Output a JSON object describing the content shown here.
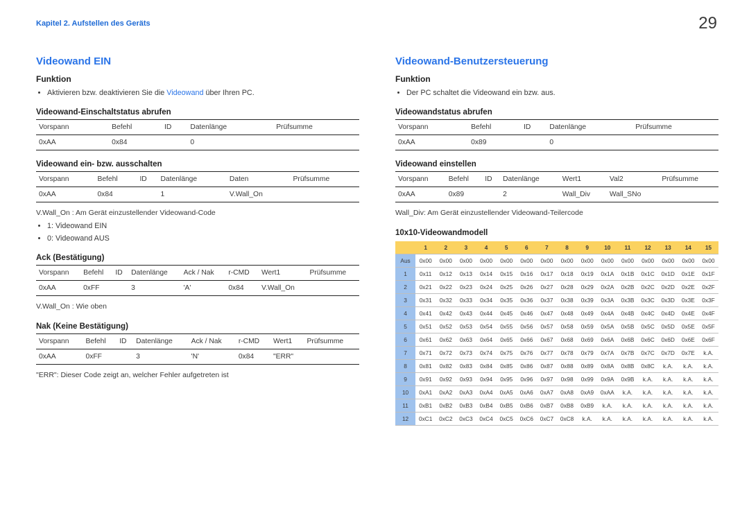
{
  "page": {
    "number": "29",
    "chapter": "Kapitel 2. Aufstellen des Geräts"
  },
  "left": {
    "title": "Videowand EIN",
    "func_h": "Funktion",
    "func_bullet_pre": "Aktivieren bzw. deaktivieren Sie die ",
    "func_bullet_accent": "Videowand",
    "func_bullet_post": " über Ihren PC.",
    "sec1_h": "Videowand-Einschaltstatus abrufen",
    "sec1_head": [
      "Vorspann",
      "Befehl",
      "ID",
      "Datenlänge",
      "Prüfsumme"
    ],
    "sec1_row": [
      "0xAA",
      "0x84",
      "",
      "0",
      ""
    ],
    "sec2_h": "Videowand ein- bzw. ausschalten",
    "sec2_head": [
      "Vorspann",
      "Befehl",
      "ID",
      "Datenlänge",
      "Daten",
      "Prüfsumme"
    ],
    "sec2_row": [
      "0xAA",
      "0x84",
      "",
      "1",
      "V.Wall_On",
      ""
    ],
    "vwall_note": "V.Wall_On : Am Gerät einzustellender Videowand-Code",
    "vwall_li1": "1: Videowand EIN",
    "vwall_li2": "0: Videowand AUS",
    "ack_h": "Ack (Bestätigung)",
    "ack_head": [
      "Vorspann",
      "Befehl",
      "ID",
      "Datenlänge",
      "Ack / Nak",
      "r-CMD",
      "Wert1",
      "Prüfsumme"
    ],
    "ack_row": [
      "0xAA",
      "0xFF",
      "",
      "3",
      "'A'",
      "0x84",
      "V.Wall_On",
      ""
    ],
    "ack_note": "V.Wall_On : Wie oben",
    "nak_h": "Nak (Keine Bestätigung)",
    "nak_head": [
      "Vorspann",
      "Befehl",
      "ID",
      "Datenlänge",
      "Ack / Nak",
      "r-CMD",
      "Wert1",
      "Prüfsumme"
    ],
    "nak_row": [
      "0xAA",
      "0xFF",
      "",
      "3",
      "'N'",
      "0x84",
      "\"ERR\"",
      ""
    ],
    "err_note": "\"ERR\": Dieser Code zeigt an, welcher Fehler aufgetreten ist"
  },
  "right": {
    "title": "Videowand-Benutzersteuerung",
    "func_h": "Funktion",
    "func_bullet": "Der PC schaltet die Videowand ein bzw. aus.",
    "sec1_h": "Videowandstatus abrufen",
    "sec1_head": [
      "Vorspann",
      "Befehl",
      "ID",
      "Datenlänge",
      "Prüfsumme"
    ],
    "sec1_row": [
      "0xAA",
      "0x89",
      "",
      "0",
      ""
    ],
    "sec2_h": "Videowand einstellen",
    "sec2_head": [
      "Vorspann",
      "Befehl",
      "ID",
      "Datenlänge",
      "Wert1",
      "Val2",
      "Prüfsumme"
    ],
    "sec2_row": [
      "0xAA",
      "0x89",
      "",
      "2",
      "Wall_Div",
      "Wall_SNo",
      ""
    ],
    "wall_div_note": "Wall_Div: Am Gerät einzustellender Videowand-Teilercode",
    "matrix_h": "10x10-Videowandmodell"
  },
  "matrix": {
    "col_head": [
      "",
      "1",
      "2",
      "3",
      "4",
      "5",
      "6",
      "7",
      "8",
      "9",
      "10",
      "11",
      "12",
      "13",
      "14",
      "15"
    ],
    "rows": [
      {
        "h": "Aus",
        "c": [
          "0x00",
          "0x00",
          "0x00",
          "0x00",
          "0x00",
          "0x00",
          "0x00",
          "0x00",
          "0x00",
          "0x00",
          "0x00",
          "0x00",
          "0x00",
          "0x00",
          "0x00"
        ]
      },
      {
        "h": "1",
        "c": [
          "0x11",
          "0x12",
          "0x13",
          "0x14",
          "0x15",
          "0x16",
          "0x17",
          "0x18",
          "0x19",
          "0x1A",
          "0x1B",
          "0x1C",
          "0x1D",
          "0x1E",
          "0x1F"
        ]
      },
      {
        "h": "2",
        "c": [
          "0x21",
          "0x22",
          "0x23",
          "0x24",
          "0x25",
          "0x26",
          "0x27",
          "0x28",
          "0x29",
          "0x2A",
          "0x2B",
          "0x2C",
          "0x2D",
          "0x2E",
          "0x2F"
        ]
      },
      {
        "h": "3",
        "c": [
          "0x31",
          "0x32",
          "0x33",
          "0x34",
          "0x35",
          "0x36",
          "0x37",
          "0x38",
          "0x39",
          "0x3A",
          "0x3B",
          "0x3C",
          "0x3D",
          "0x3E",
          "0x3F"
        ]
      },
      {
        "h": "4",
        "c": [
          "0x41",
          "0x42",
          "0x43",
          "0x44",
          "0x45",
          "0x46",
          "0x47",
          "0x48",
          "0x49",
          "0x4A",
          "0x4B",
          "0x4C",
          "0x4D",
          "0x4E",
          "0x4F"
        ]
      },
      {
        "h": "5",
        "c": [
          "0x51",
          "0x52",
          "0x53",
          "0x54",
          "0x55",
          "0x56",
          "0x57",
          "0x58",
          "0x59",
          "0x5A",
          "0x5B",
          "0x5C",
          "0x5D",
          "0x5E",
          "0x5F"
        ]
      },
      {
        "h": "6",
        "c": [
          "0x61",
          "0x62",
          "0x63",
          "0x64",
          "0x65",
          "0x66",
          "0x67",
          "0x68",
          "0x69",
          "0x6A",
          "0x6B",
          "0x6C",
          "0x6D",
          "0x6E",
          "0x6F"
        ]
      },
      {
        "h": "7",
        "c": [
          "0x71",
          "0x72",
          "0x73",
          "0x74",
          "0x75",
          "0x76",
          "0x77",
          "0x78",
          "0x79",
          "0x7A",
          "0x7B",
          "0x7C",
          "0x7D",
          "0x7E",
          "k.A."
        ]
      },
      {
        "h": "8",
        "c": [
          "0x81",
          "0x82",
          "0x83",
          "0x84",
          "0x85",
          "0x86",
          "0x87",
          "0x88",
          "0x89",
          "0x8A",
          "0x8B",
          "0x8C",
          "k.A.",
          "k.A.",
          "k.A."
        ]
      },
      {
        "h": "9",
        "c": [
          "0x91",
          "0x92",
          "0x93",
          "0x94",
          "0x95",
          "0x96",
          "0x97",
          "0x98",
          "0x99",
          "0x9A",
          "0x9B",
          "k.A.",
          "k.A.",
          "k.A.",
          "k.A."
        ]
      },
      {
        "h": "10",
        "c": [
          "0xA1",
          "0xA2",
          "0xA3",
          "0xA4",
          "0xA5",
          "0xA6",
          "0xA7",
          "0xA8",
          "0xA9",
          "0xAA",
          "k.A.",
          "k.A.",
          "k.A.",
          "k.A.",
          "k.A."
        ]
      },
      {
        "h": "11",
        "c": [
          "0xB1",
          "0xB2",
          "0xB3",
          "0xB4",
          "0xB5",
          "0xB6",
          "0xB7",
          "0xB8",
          "0xB9",
          "k.A.",
          "k.A.",
          "k.A.",
          "k.A.",
          "k.A.",
          "k.A."
        ]
      },
      {
        "h": "12",
        "c": [
          "0xC1",
          "0xC2",
          "0xC3",
          "0xC4",
          "0xC5",
          "0xC6",
          "0xC7",
          "0xC8",
          "k.A.",
          "k.A.",
          "k.A.",
          "k.A.",
          "k.A.",
          "k.A.",
          "k.A."
        ]
      }
    ]
  }
}
